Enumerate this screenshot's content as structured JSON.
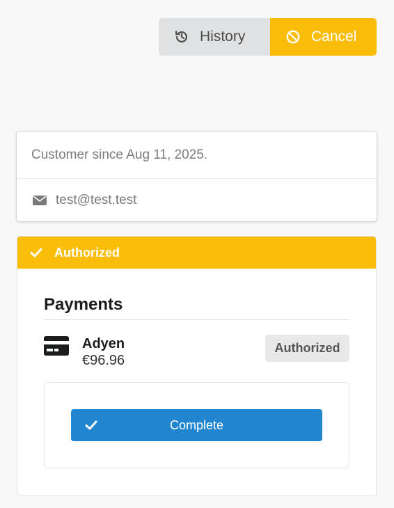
{
  "toolbar": {
    "history_label": "History",
    "history_icon": "history-icon",
    "cancel_label": "Cancel",
    "cancel_icon": "ban-icon",
    "cancel_color": "#fbbd08",
    "history_color": "#e0e1e2"
  },
  "customer": {
    "since_text": "Customer since Aug 11, 2025.",
    "email": "test@test.test",
    "email_icon": "envelope-icon"
  },
  "status": {
    "label": "Authorized",
    "icon": "checkmark-icon",
    "color": "#fbbd08"
  },
  "payments": {
    "title": "Payments",
    "items": [
      {
        "provider": "Adyen",
        "amount": "€96.96",
        "status": "Authorized",
        "icon": "credit-card-icon"
      }
    ],
    "complete_label": "Complete",
    "complete_icon": "checkmark-icon",
    "complete_color": "#2185d0"
  }
}
